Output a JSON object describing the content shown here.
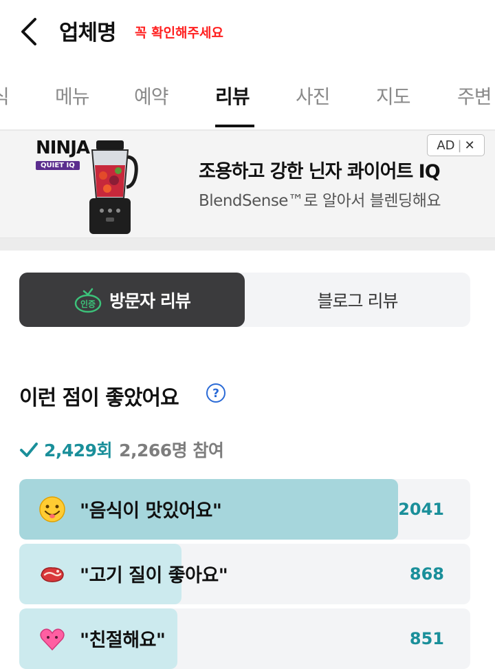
{
  "header": {
    "title": "업체명",
    "notice": "꼭 확인해주세요"
  },
  "tabs": [
    {
      "label": "식"
    },
    {
      "label": "메뉴"
    },
    {
      "label": "예약"
    },
    {
      "label": "리뷰"
    },
    {
      "label": "사진"
    },
    {
      "label": "지도"
    },
    {
      "label": "주변"
    }
  ],
  "active_tab": "리뷰",
  "ad": {
    "brand_name": "NINJA",
    "brand_sub": "QUIET IQ",
    "headline": "조용하고 강한 닌자 콰이어트 IQ",
    "subline": "BlendSense™로 알아서 블렌딩해요",
    "badge": "AD",
    "close": "✕"
  },
  "review_toggle": {
    "visitor_label": "방문자 리뷰",
    "visitor_badge": "인증",
    "blog_label": "블로그 리뷰"
  },
  "section": {
    "title": "이런 점이 좋았어요",
    "help": "?"
  },
  "stats": {
    "count": "2,429회",
    "participants": "2,266명 참여"
  },
  "keywords": [
    {
      "text": "\"음식이 맛있어요\"",
      "count": "2041",
      "icon": "smiling-face-emoji",
      "level": 0.84
    },
    {
      "text": "\"고기 질이 좋아요\"",
      "count": "868",
      "icon": "meat-emoji",
      "level": 0.36
    },
    {
      "text": "\"친절해요\"",
      "count": "851",
      "icon": "heart-emoji",
      "level": 0.35
    }
  ],
  "colors": {
    "accent": "#1a8f9a",
    "bar_top": "#a6d6dc",
    "bar": "#cceaee",
    "notice": "#ff1f1f",
    "dark": "#3b3b3d"
  }
}
